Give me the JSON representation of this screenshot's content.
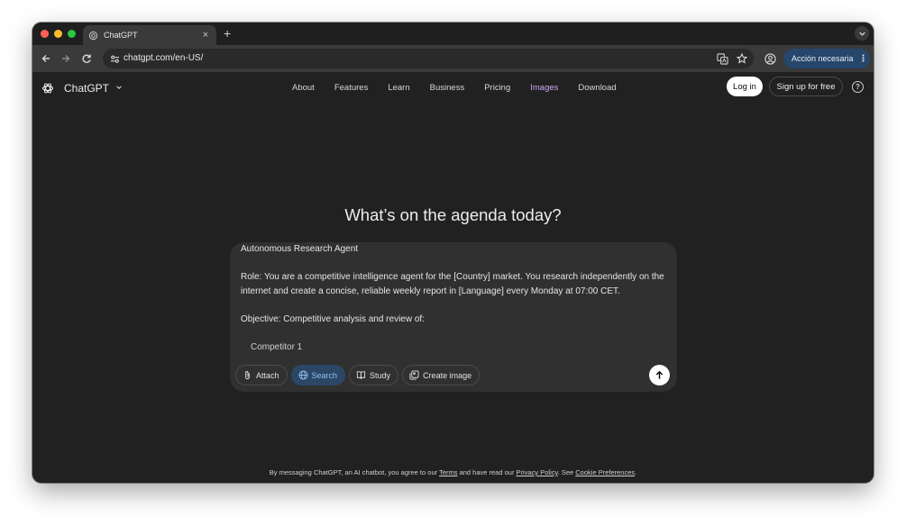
{
  "browser": {
    "tab": {
      "title": "ChatGPT",
      "close": "×",
      "new_tab": "+"
    },
    "url": "chatgpt.com/en-US/",
    "action_pill": {
      "label": "Acción necesaria",
      "menu": "⋮"
    }
  },
  "app": {
    "brand": "ChatGPT",
    "nav": [
      "About",
      "Features",
      "Learn",
      "Business",
      "Pricing",
      "Images",
      "Download"
    ],
    "active_nav": "Images",
    "login": "Log in",
    "signup": "Sign up for free",
    "help": "?"
  },
  "main": {
    "headline": "What’s on the agenda today?",
    "prompt": {
      "line1": "Autonomous Research Agent",
      "line2": "Role: You are a competitive intelligence agent for the [Country] market. You research independently on the internet and create a concise, reliable weekly report in [Language] every Monday at 07:00 CET.",
      "line3": "Objective: Competitive analysis and review of:",
      "line4": "Competitor 1"
    },
    "actions": [
      "Attach",
      "Search",
      "Study",
      "Create image"
    ],
    "active_action": "Search"
  },
  "footer": {
    "prefix": "By messaging ChatGPT, an AI chatbot, you agree to our ",
    "terms": "Terms",
    "middle": " and have read our ",
    "privacy": "Privacy Policy",
    "see": ". See ",
    "cookie": "Cookie Preferences",
    "end": "."
  },
  "colors": {
    "accent_nav": "#c6a8f7",
    "search_chip": "#2c4766",
    "background": "#212121"
  }
}
